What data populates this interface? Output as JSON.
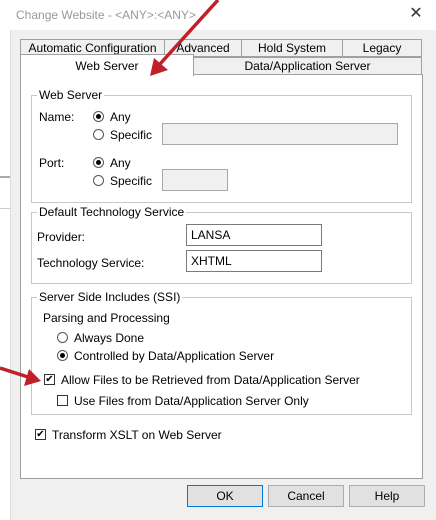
{
  "window": {
    "title": "Change Website - <ANY>:<ANY>",
    "close_glyph": "✕"
  },
  "tabs": {
    "row1": [
      "Automatic Configuration",
      "Advanced",
      "Hold System",
      "Legacy"
    ],
    "row2": [
      "Web Server",
      "Data/Application Server"
    ],
    "active": "Web Server"
  },
  "web_server": {
    "legend": "Web Server",
    "name_label": "Name:",
    "name_any": "Any",
    "name_specific": "Specific",
    "name_value": "",
    "port_label": "Port:",
    "port_any": "Any",
    "port_specific": "Specific",
    "port_value": ""
  },
  "default_tech": {
    "legend": "Default Technology Service",
    "provider_label": "Provider:",
    "provider_value": "LANSA",
    "service_label": "Technology Service:",
    "service_value": "XHTML"
  },
  "ssi": {
    "legend": "Server Side Includes (SSI)",
    "parsing_label": "Parsing and Processing",
    "always_done": "Always Done",
    "controlled_by": "Controlled by Data/Application Server",
    "allow_files": "Allow Files to be Retrieved from Data/Application Server",
    "use_files": "Use Files from Data/Application Server Only"
  },
  "transform": {
    "label": "Transform XSLT on Web Server"
  },
  "buttons": {
    "ok": "OK",
    "cancel": "Cancel",
    "help": "Help"
  },
  "check_glyph": "✔",
  "colors": {
    "arrow": "#c0202a",
    "default_button_border": "#0078d7"
  }
}
